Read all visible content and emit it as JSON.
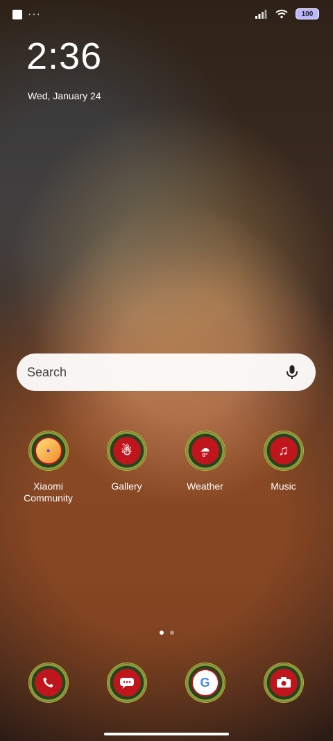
{
  "status_bar": {
    "dots": "···",
    "battery": "100",
    "icons": [
      "notification-square-icon",
      "more-dots-icon",
      "signal-icon",
      "wifi-icon",
      "battery-icon"
    ]
  },
  "lock_clock": {
    "time": "2:36",
    "date": "Wed, January 24"
  },
  "search": {
    "placeholder": "Search",
    "icons": [
      "mic-icon"
    ]
  },
  "home": {
    "apps_row1": [
      {
        "label": "Xiaomi\nCommunity",
        "icon": "xiaomi-community-icon"
      },
      {
        "label": "Gallery",
        "icon": "gallery-icon"
      },
      {
        "label": "Weather",
        "icon": "weather-icon",
        "badge": "0°"
      },
      {
        "label": "Music",
        "icon": "music-icon"
      }
    ],
    "dock": [
      {
        "icon": "phone-icon"
      },
      {
        "icon": "messages-icon"
      },
      {
        "icon": "google-icon"
      },
      {
        "icon": "camera-icon"
      }
    ],
    "page_indicator": {
      "pages": 2,
      "active": 1
    }
  },
  "colors": {
    "search_bg": "#ffffff",
    "icon_red": "#c0151c",
    "wreath_green": "#355b27",
    "battery": "#b8b7ff"
  }
}
